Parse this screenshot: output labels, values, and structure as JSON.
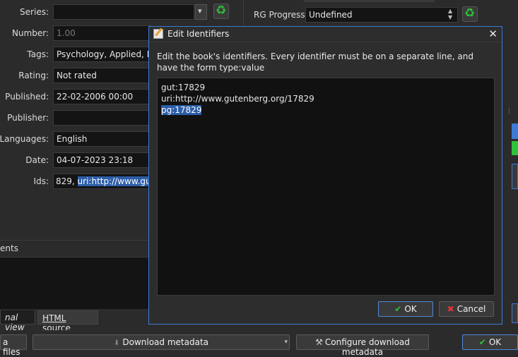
{
  "form": {
    "series_label": "Series:",
    "series_value": "",
    "number_label": "Number:",
    "number_value": "1.00",
    "tags_label": "Tags:",
    "tags_value": "Psychology, Applied, Me",
    "rating_label": "Rating:",
    "rating_value": "Not rated",
    "published_label": "Published:",
    "published_value": "22-02-2006 00:00",
    "publisher_label": "Publisher:",
    "publisher_value": "",
    "languages_label": "Languages:",
    "languages_value": "English",
    "date_label": "Date:",
    "date_value": "04-07-2023 23:18",
    "ids_label": "Ids:",
    "ids_prefix": "829, ",
    "ids_selected": "uri:http://www.guter"
  },
  "right_panel": {
    "rg_progress_label": "RG Progress:",
    "rg_progress_value": "Undefined"
  },
  "comments_label": "ents",
  "tabs": {
    "normal_view": "nal view",
    "html_source": "HTML source"
  },
  "bottom_bar": {
    "data_files": "a files",
    "download_metadata": "Download metadata",
    "configure_download": "Configure download metadata",
    "ok": "OK"
  },
  "dialog": {
    "title": "Edit Identifiers",
    "description": "Edit the book's identifiers. Every identifier must be on a separate line, and have the form type:value",
    "lines": [
      "gut:17829",
      "uri:http://www.gutenberg.org/17829"
    ],
    "selected_line": "pg:17829",
    "ok_label": "OK",
    "cancel_label": "Cancel"
  },
  "colors": {
    "background": "#2b2b2b",
    "field_bg": "#141414",
    "accent": "#3a7bd5",
    "selection": "#2c5ea8",
    "ok_green": "#2fc23a",
    "cancel_red": "#e23535"
  }
}
